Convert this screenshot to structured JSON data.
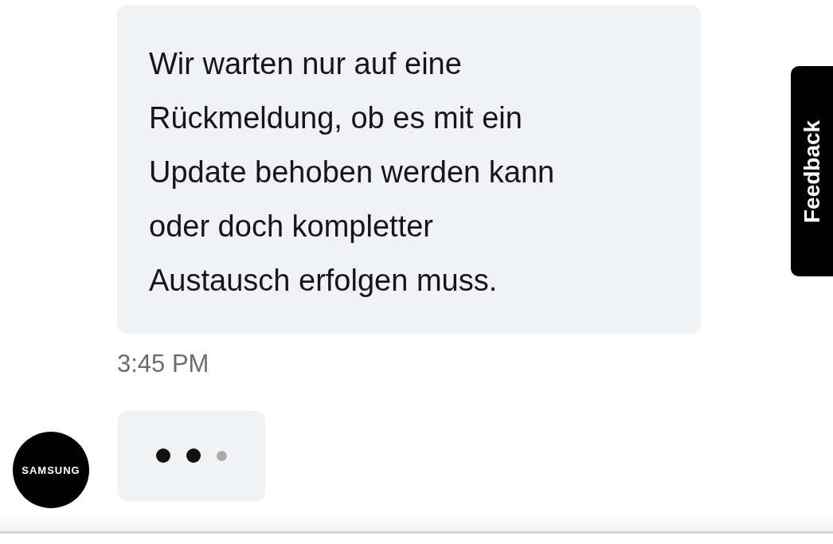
{
  "message": {
    "text": "Wir warten nur auf eine\nRückmeldung, ob es mit ein\nUpdate behoben werden kann\noder doch kompletter\nAustausch erfolgen muss.",
    "time": "3:45 PM"
  },
  "agent": {
    "avatar_label": "SAMSUNG"
  },
  "typing_dots": [
    {
      "on": true
    },
    {
      "on": true
    },
    {
      "on": false
    }
  ],
  "feedback_tab": {
    "label": "Feedback"
  }
}
